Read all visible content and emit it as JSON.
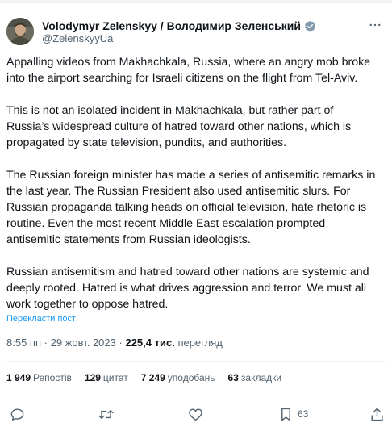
{
  "author": {
    "display_name": "Volodymyr Zelenskyy / Володимир Зеленський",
    "handle": "@ZelenskyyUa",
    "verified": true
  },
  "tweet": {
    "text": "Appalling videos from Makhachkala, Russia, where an angry mob broke\ninto the airport searching for Israeli citizens on the flight from Tel-Aviv.\n\nThis is not an isolated incident in Makhachkala, but rather part of\nRussia’s widespread culture of hatred toward other nations, which is\npropagated by state television, pundits, and authorities.\n\nThe Russian foreign minister has made a series of antisemitic remarks in\nthe last year. The Russian President also used antisemitic slurs. For\nRussian propaganda talking heads on official television, hate rhetoric is\nroutine. Even the most recent Middle East escalation prompted\nantisemitic statements from Russian ideologists.\n\nRussian antisemitism and hatred toward other nations are systemic and\ndeeply rooted. Hatred is what drives aggression and terror. We must all\nwork together to oppose hatred.",
    "translate_label": "Перекласти пост"
  },
  "meta": {
    "time": "8:55 пп",
    "separator": "·",
    "date": "29 жовт. 2023",
    "views_count": "225,4 тис.",
    "views_label": "перегляд"
  },
  "stats": [
    {
      "num": "1 949",
      "label": "Репостів"
    },
    {
      "num": "129",
      "label": "цитат"
    },
    {
      "num": "7 249",
      "label": "уподобань"
    },
    {
      "num": "63",
      "label": "закладки"
    }
  ],
  "actions": {
    "reply_icon": "reply-icon",
    "repost_icon": "repost-icon",
    "like_icon": "like-icon",
    "bookmark_icon": "bookmark-icon",
    "bookmark_count": "63",
    "share_icon": "share-icon"
  },
  "colors": {
    "text": "#0f1419",
    "secondary": "#536471",
    "link": "#1d9bf0",
    "divider": "#eff3f4",
    "verified_badge": "#829aab"
  }
}
